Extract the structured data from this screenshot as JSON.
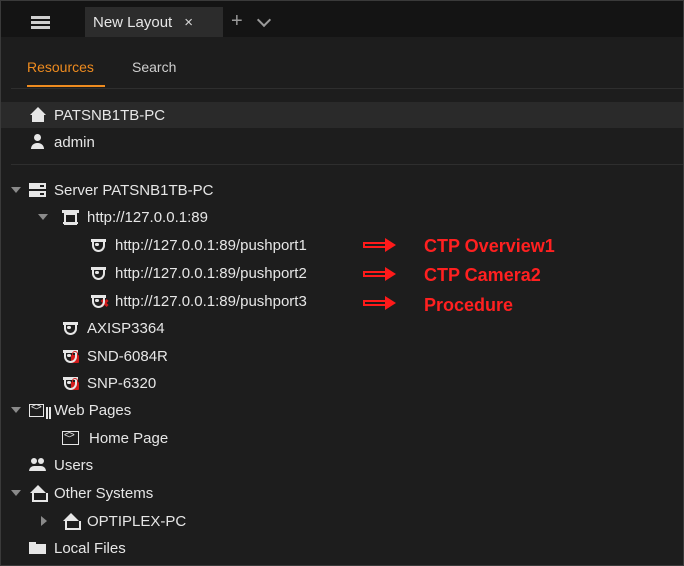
{
  "tab_bar": {
    "menu_icon": "hamburger-icon",
    "tab_label": "New Layout",
    "tab_close": "×",
    "add_tab": "+",
    "dropdown_icon": "chevron-down-icon"
  },
  "resource_tabs": [
    {
      "label": "Resources",
      "active": true
    },
    {
      "label": "Search",
      "active": false
    }
  ],
  "tree": {
    "current_system": {
      "label": "PATSNB1TB-PC",
      "icon": "home-icon"
    },
    "current_user": {
      "label": "admin",
      "icon": "user-icon"
    },
    "server": {
      "label": "Server PATSNB1TB-PC",
      "icon": "server-icon",
      "encoder": {
        "label": "http://127.0.0.1:89",
        "icon": "io-module-icon",
        "streams": [
          {
            "label": "http://127.0.0.1:89/pushport1",
            "icon": "camera-icon",
            "status": "online"
          },
          {
            "label": "http://127.0.0.1:89/pushport2",
            "icon": "camera-icon",
            "status": "online"
          },
          {
            "label": "http://127.0.0.1:89/pushport3",
            "icon": "camera-offline-icon",
            "status": "offline"
          }
        ]
      },
      "cameras": [
        {
          "label": "AXISP3364",
          "icon": "camera-icon",
          "status": "online"
        },
        {
          "label": "SND-6084R",
          "icon": "camera-locked-icon",
          "status": "unauthorized"
        },
        {
          "label": "SNP-6320",
          "icon": "camera-locked-icon",
          "status": "unauthorized"
        }
      ]
    },
    "web_pages": {
      "label": "Web Pages",
      "icon": "webpages-icon",
      "items": [
        {
          "label": "Home Page",
          "icon": "webpage-icon"
        }
      ]
    },
    "users": {
      "label": "Users",
      "icon": "users-icon"
    },
    "other_systems": {
      "label": "Other Systems",
      "icon": "home-outline-icon",
      "items": [
        {
          "label": "OPTIPLEX-PC",
          "icon": "home-outline-icon"
        }
      ]
    },
    "local_files": {
      "label": "Local Files",
      "icon": "folder-icon"
    }
  },
  "annotations": [
    {
      "text": "CTP Overview1",
      "color": "#ff2020"
    },
    {
      "text": "CTP Camera2",
      "color": "#ff2020"
    },
    {
      "text": "Procedure",
      "color": "#ff2020"
    }
  ],
  "colors": {
    "accent": "#ee8b1f",
    "background": "#1d1d1d",
    "alert": "#d11a1a"
  }
}
